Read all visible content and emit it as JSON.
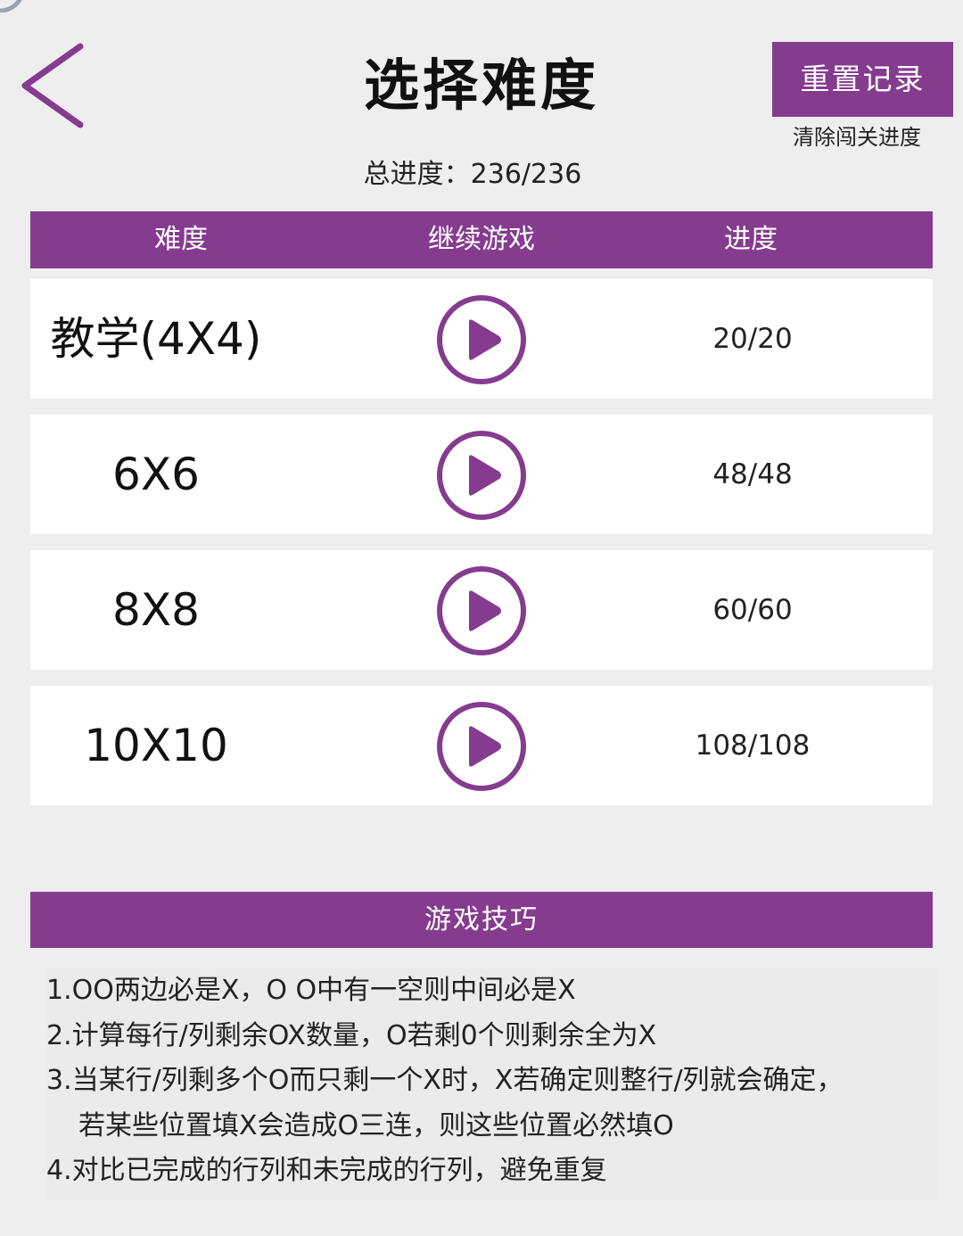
{
  "header": {
    "title": "选择难度",
    "reset_button_label": "重置记录",
    "reset_hint": "清除闯关进度",
    "total_progress": "总进度：236/236"
  },
  "table": {
    "columns": [
      "难度",
      "继续游戏",
      "进度"
    ],
    "rows": [
      {
        "level": "教学(4X4)",
        "progress": "20/20"
      },
      {
        "level": "6X6",
        "progress": "48/48"
      },
      {
        "level": "8X8",
        "progress": "60/60"
      },
      {
        "level": "10X10",
        "progress": "108/108"
      }
    ]
  },
  "tips": {
    "title": "游戏技巧",
    "lines": [
      "1.OO两边必是X，O O中有一空则中间必是X",
      "2.计算每行/列剩余OX数量，O若剩0个则剩余全为X",
      "3.当某行/列剩多个O而只剩一个X时，X若确定则整行/列就会确定，",
      "若某些位置填X会造成O三连，则这些位置必然填O",
      "4.对比已完成的行列和未完成的行列，避免重复"
    ]
  },
  "colors": {
    "accent": "#853c8f",
    "background": "#eeeeee",
    "row_background": "#ffffff"
  },
  "icons": {
    "back": "chevron-left-icon",
    "play": "play-circle-icon"
  }
}
